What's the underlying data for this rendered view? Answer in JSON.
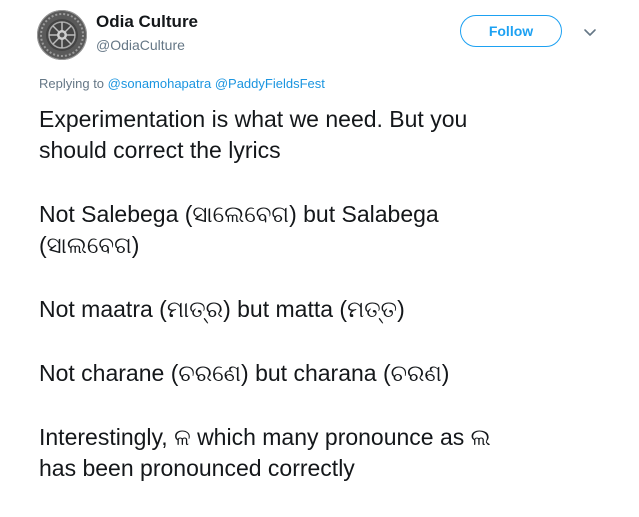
{
  "author": {
    "name": "Odia Culture",
    "handle": "@OdiaCulture",
    "avatar_icon": "odia-culture-logo"
  },
  "actions": {
    "follow_label": "Follow",
    "menu_icon": "chevron-down-icon"
  },
  "reply": {
    "prefix": "Replying to ",
    "mentions": [
      "@sonamohapatra",
      "@PaddyFieldsFest"
    ]
  },
  "tweet": {
    "paragraphs": [
      "Experimentation is what we need. But you\nshould correct the lyrics",
      "Not Salebega (ସାଲେବେଗ) but Salabega\n(ସାଲବେଗ)",
      "Not maatra (ମାତ୍ର) but matta (ମତ୍ତ)",
      "Not charane (ଚରଣେ) but charana (ଚରଣ)",
      "Interestingly, ଳ which many pronounce as ଲ\nhas been pronounced correctly"
    ]
  },
  "colors": {
    "accent": "#1da1f2",
    "mention": "#1b95e0",
    "secondary_text": "#657786",
    "primary_text": "#14171a"
  }
}
